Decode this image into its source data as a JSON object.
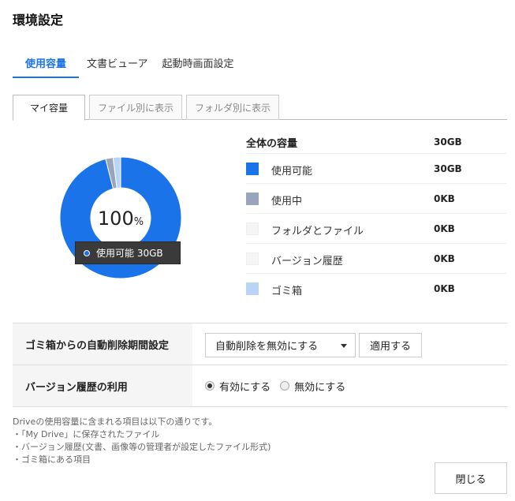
{
  "title": "環境設定",
  "tabs": [
    {
      "label": "使用容量"
    },
    {
      "label": "文書ビューア"
    },
    {
      "label": "起動時画面設定"
    }
  ],
  "subtabs": [
    {
      "label": "マイ容量"
    },
    {
      "label": "ファイル別に表示"
    },
    {
      "label": "フォルダ別に表示"
    }
  ],
  "donut": {
    "percent": "100",
    "unit": "%",
    "tooltip": "使用可能 30GB",
    "slices": [
      {
        "name": "使用可能",
        "fraction": 0.96,
        "color": "#1a73e8"
      },
      {
        "name": "使用中",
        "fraction": 0.02,
        "color": "#9aa5bd"
      },
      {
        "name": "ゴミ箱",
        "fraction": 0.02,
        "color": "#b9d4f5"
      }
    ]
  },
  "legend": {
    "header_label": "全体の容量",
    "header_value": "30GB",
    "items": [
      {
        "label": "使用可能",
        "value": "30GB",
        "color": "#1a73e8"
      },
      {
        "label": "使用中",
        "value": "0KB",
        "color": "#9aa5bd"
      },
      {
        "label": "フォルダとファイル",
        "value": "0KB",
        "color": "#f5f5f5"
      },
      {
        "label": "バージョン履歴",
        "value": "0KB",
        "color": "#f5f5f5"
      },
      {
        "label": "ゴミ箱",
        "value": "0KB",
        "color": "#b9d4f5"
      }
    ]
  },
  "settings": {
    "trash_label": "ゴミ箱からの自動削除期間設定",
    "trash_select": "自動削除を無効にする",
    "apply_label": "適用する",
    "version_label": "バージョン履歴の利用",
    "radio_enable": "有効にする",
    "radio_disable": "無効にする"
  },
  "notes": [
    "Driveの使用容量に含まれる項目は以下の通りです。",
    "・「My Drive」に保存されたファイル",
    "・バージョン履歴(文書、画像等の管理者が設定したファイル形式)",
    "・ゴミ箱にある項目"
  ],
  "close_label": "閉じる"
}
